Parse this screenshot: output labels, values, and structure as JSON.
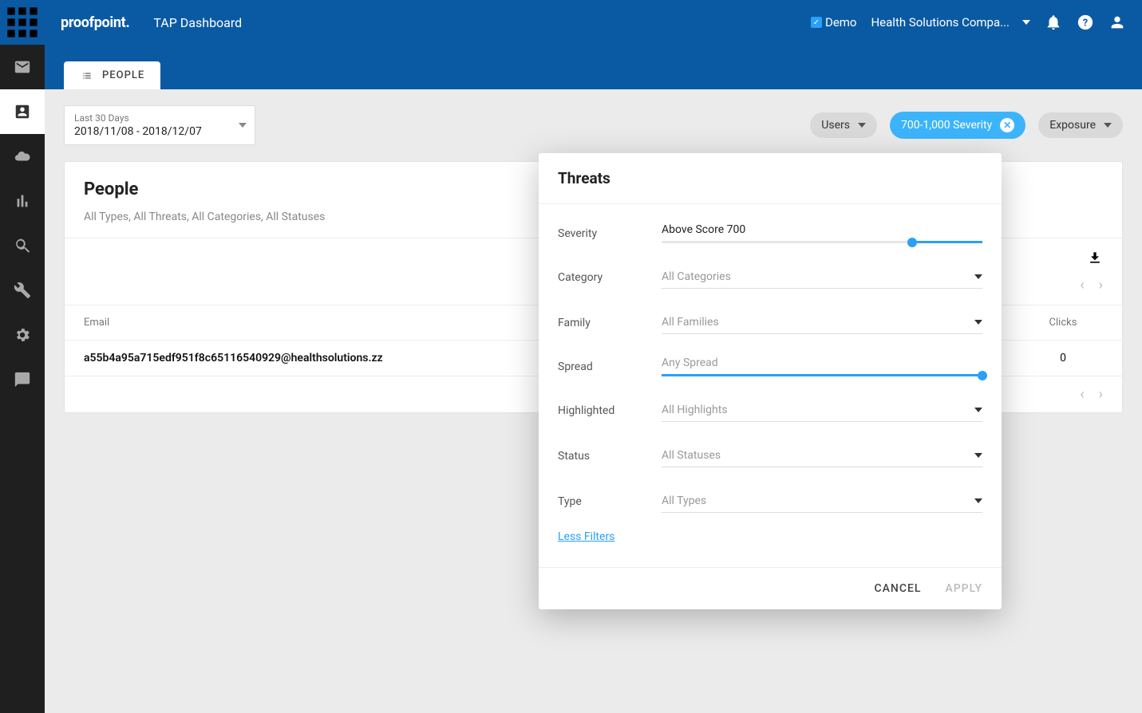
{
  "header": {
    "logo": "proofpoint.",
    "app_title": "TAP Dashboard",
    "demo_label": "Demo",
    "org_name": "Health Solutions Compa..."
  },
  "tabs": {
    "people": "PEOPLE"
  },
  "daterange": {
    "caption": "Last 30 Days",
    "value": "2018/11/08 - 2018/12/07"
  },
  "pills": {
    "users": "Users",
    "severity_filter": "700-1,000 Severity",
    "exposure": "Exposure"
  },
  "card": {
    "title": "People",
    "filter_summary": "All Types, All Threats, All Categories, All Statuses",
    "columns": {
      "email": "Email",
      "clicks": "Clicks"
    },
    "rows": [
      {
        "email": "a55b4a95a715edf951f8c65116540929@healthsolutions.zz",
        "clicks": "0"
      }
    ]
  },
  "popover": {
    "title": "Threats",
    "severity": {
      "label": "Severity",
      "value_text": "Above Score 700",
      "thumb_pct": 78
    },
    "category": {
      "label": "Category",
      "value": "All Categories"
    },
    "family": {
      "label": "Family",
      "value": "All Families"
    },
    "spread": {
      "label": "Spread",
      "value_text": "Any Spread"
    },
    "highlighted": {
      "label": "Highlighted",
      "value": "All Highlights"
    },
    "status": {
      "label": "Status",
      "value": "All Statuses"
    },
    "type": {
      "label": "Type",
      "value": "All Types"
    },
    "less_filters": "Less Filters",
    "cancel": "CANCEL",
    "apply": "APPLY"
  }
}
